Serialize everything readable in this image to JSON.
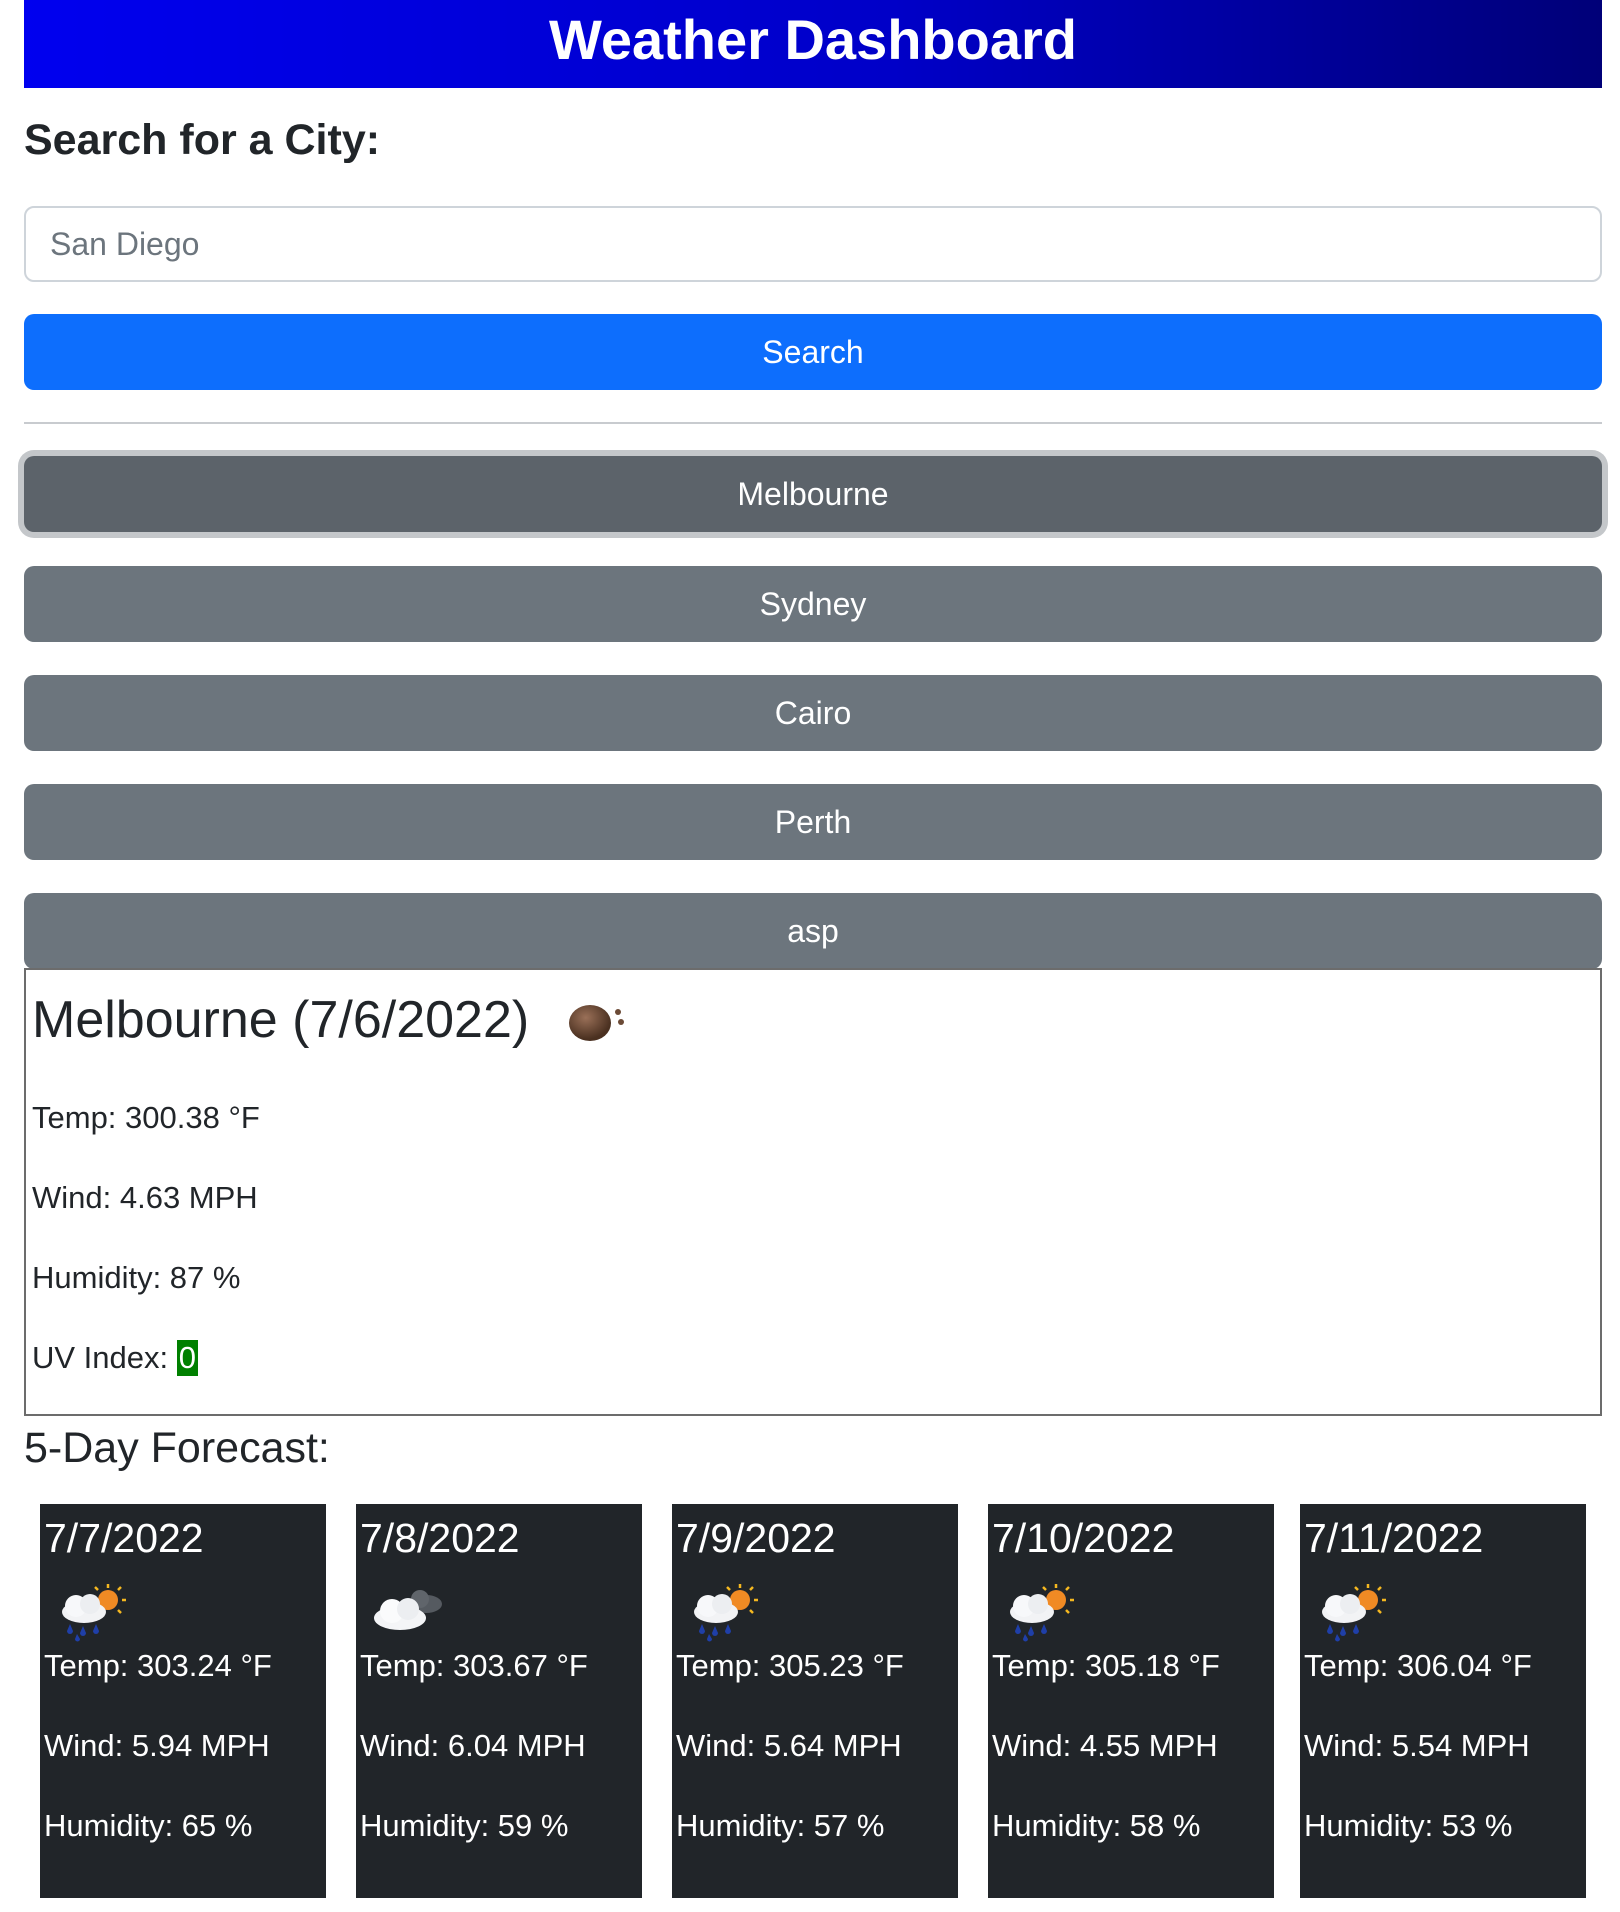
{
  "header": {
    "title": "Weather Dashboard"
  },
  "search": {
    "heading": "Search for a City:",
    "input_value": "San Diego",
    "button_label": "Search"
  },
  "history": {
    "cities": [
      "Melbourne",
      "Sydney",
      "Cairo",
      "Perth",
      "asp"
    ],
    "active": "Melbourne"
  },
  "current": {
    "title": "Melbourne (7/6/2022)",
    "icon": "mist-haze-icon",
    "temp": "Temp: 300.38 °F",
    "wind": "Wind: 4.63 MPH",
    "humidity": "Humidity: 87 %",
    "uv_label": "UV Index: ",
    "uv_value": "0",
    "uv_color": "#008000"
  },
  "forecast": {
    "heading": "5-Day Forecast:",
    "days": [
      {
        "date": "7/7/2022",
        "icon": "rain-sun-icon",
        "temp": "Temp: 303.24 °F",
        "wind": "Wind: 5.94 MPH",
        "humidity": "Humidity: 65 %"
      },
      {
        "date": "7/8/2022",
        "icon": "cloudy-night-icon",
        "temp": "Temp: 303.67 °F",
        "wind": "Wind: 6.04 MPH",
        "humidity": "Humidity: 59 %"
      },
      {
        "date": "7/9/2022",
        "icon": "rain-sun-icon",
        "temp": "Temp: 305.23 °F",
        "wind": "Wind: 5.64 MPH",
        "humidity": "Humidity: 57 %"
      },
      {
        "date": "7/10/2022",
        "icon": "rain-sun-icon",
        "temp": "Temp: 305.18 °F",
        "wind": "Wind: 4.55 MPH",
        "humidity": "Humidity: 58 %"
      },
      {
        "date": "7/11/2022",
        "icon": "rain-sun-icon",
        "temp": "Temp: 306.04 °F",
        "wind": "Wind: 5.54 MPH",
        "humidity": "Humidity: 53 %"
      }
    ]
  },
  "colors": {
    "header_gradient_start": "#0000ef",
    "header_gradient_end": "#000078",
    "primary_button": "#0d6efd",
    "history_button": "#6c757d",
    "forecast_card": "#212529"
  }
}
